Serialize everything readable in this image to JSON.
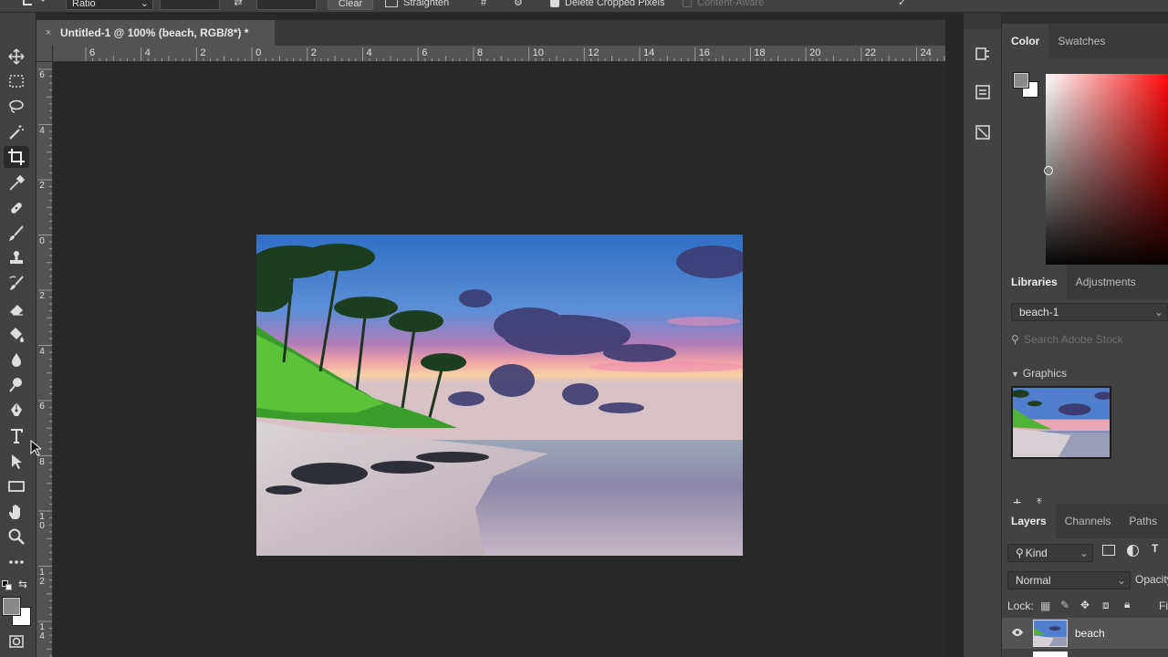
{
  "options_bar": {
    "ratio_label": "Ratio",
    "clear_label": "Clear",
    "straighten_label": "Straighten",
    "delete_cropped_label": "Delete Cropped Pixels",
    "content_aware_label": "Content-Aware"
  },
  "document": {
    "tab_title": "Untitled-1 @ 100% (beach, RGB/8*) *",
    "close_glyph": "×"
  },
  "rulers": {
    "top_labels": [
      "6",
      "4",
      "2",
      "0",
      "2",
      "4",
      "6",
      "8",
      "10",
      "12",
      "14",
      "16",
      "18",
      "20",
      "22",
      "24"
    ],
    "left_labels": [
      "6",
      "4",
      "2",
      "0",
      "2",
      "4",
      "6",
      "8",
      "1 0",
      "1 2",
      "1 4"
    ]
  },
  "toolbar": {
    "tools": [
      "move-tool",
      "marquee-tool",
      "lasso-tool",
      "magic-wand-tool",
      "crop-tool",
      "eyedropper-tool",
      "healing-brush-tool",
      "brush-tool",
      "clone-stamp-tool",
      "history-brush-tool",
      "eraser-tool",
      "paint-bucket-tool",
      "blur-tool",
      "dodge-tool",
      "pen-tool",
      "type-tool",
      "path-selection-tool",
      "rectangle-tool",
      "hand-tool",
      "zoom-tool",
      "more-tools",
      "swap-colors",
      "foreground-background-colors",
      "quick-mask"
    ],
    "active_tool": "crop-tool",
    "foreground_color": "#8a8a8a",
    "background_color": "#ffffff"
  },
  "color_panel": {
    "tabs": [
      "Color",
      "Swatches"
    ],
    "active_tab": "Color",
    "foreground_color": "#8a8a8a",
    "background_color": "#ffffff",
    "hue_color": "#ff0000"
  },
  "libraries_panel": {
    "tabs": [
      "Libraries",
      "Adjustments"
    ],
    "active_tab": "Libraries",
    "library_name": "beach-1",
    "search_placeholder": "Search Adobe Stock",
    "section_title": "Graphics"
  },
  "layers_panel": {
    "tabs": [
      "Layers",
      "Channels",
      "Paths"
    ],
    "active_tab": "Layers",
    "filter_kind": "Kind",
    "blend_mode": "Normal",
    "opacity_label": "Opacity",
    "lock_label": "Lock:",
    "fill_label": "Fi",
    "layers": [
      {
        "name": "beach",
        "visible": true
      }
    ]
  }
}
